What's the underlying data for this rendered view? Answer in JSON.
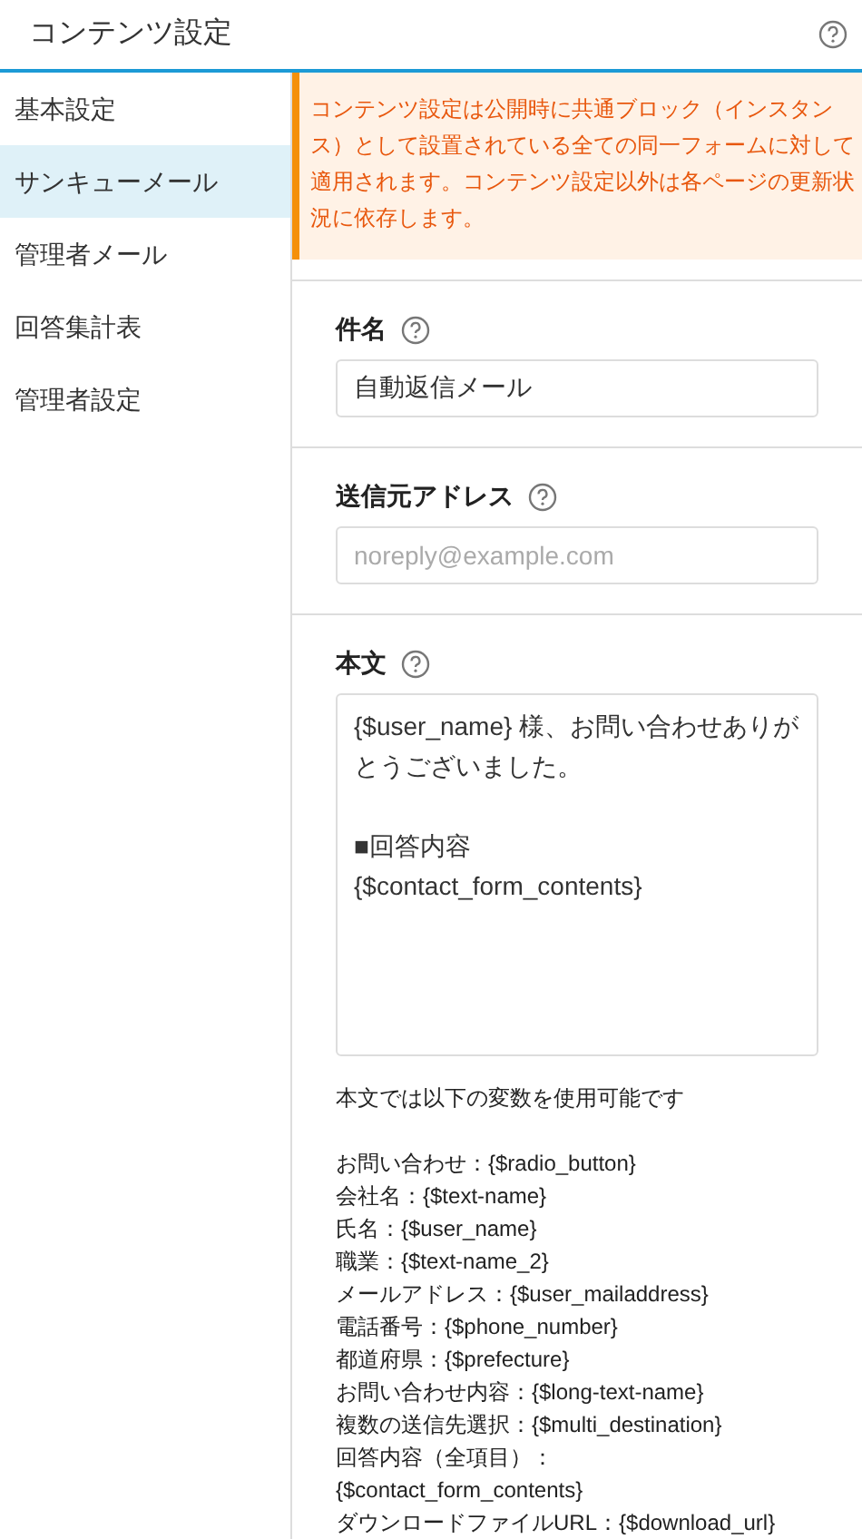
{
  "header": {
    "title": "コンテンツ設定"
  },
  "sidebar": {
    "items": [
      {
        "label": "基本設定",
        "selected": false
      },
      {
        "label": "サンキューメール",
        "selected": true
      },
      {
        "label": "管理者メール",
        "selected": false
      },
      {
        "label": "回答集計表",
        "selected": false
      },
      {
        "label": "管理者設定",
        "selected": false
      }
    ]
  },
  "notice": "コンテンツ設定は公開時に共通ブロック（インスタンス）として設置されている全ての同一フォームに対して適用されます。コンテンツ設定以外は各ページの更新状況に依存します。",
  "fields": [
    {
      "label": "件名",
      "kind": "input",
      "value": "自動返信メール"
    },
    {
      "label": "送信元アドレス",
      "kind": "input",
      "placeholder": "noreply@example.com"
    },
    {
      "label": "本文",
      "kind": "textarea",
      "value": "{$user_name} 様、お問い合わせありがとうございました。\n\n■回答内容\n{$contact_form_contents}"
    }
  ],
  "variables": {
    "intro": "本文では以下の変数を使用可能です",
    "lines": [
      "お問い合わせ：{$radio_button}",
      "会社名：{$text-name}",
      "氏名：{$user_name}",
      "職業：{$text-name_2}",
      "メールアドレス：{$user_mailaddress}",
      "電話番号：{$phone_number}",
      "都道府県：{$prefecture}",
      "お問い合わせ内容：{$long-text-name}",
      "複数の送信先選択：{$multi_destination}",
      "回答内容（全項目）：",
      "{$contact_form_contents}",
      "ダウンロードファイルURL：{$download_url}"
    ]
  }
}
